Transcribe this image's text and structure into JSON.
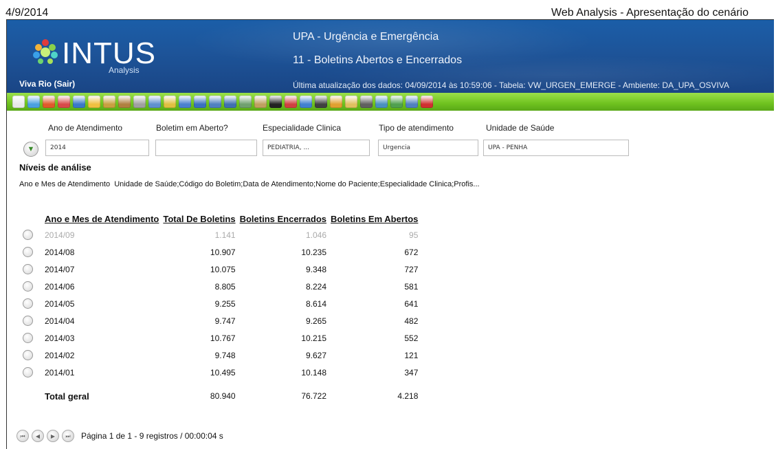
{
  "print_header": {
    "date": "4/9/2014",
    "title": "Web Analysis - Apresentação do cenário"
  },
  "banner": {
    "logo_text": "INTUS",
    "logo_sub": "Analysis",
    "user_link": "Viva Rio (Sair)",
    "report_title": "UPA - Urgência e Emergência",
    "report_subtitle": "11 - Boletins Abertos e Encerrados",
    "update_info": "Última atualização dos dados: 04/09/2014 às 10:59:06 - Tabela: VW_URGEN_EMERGE - Ambiente: DA_UPA_OSVIVA"
  },
  "toolbar": {
    "icons": [
      {
        "name": "home-icon",
        "color": "#e8e8e8"
      },
      {
        "name": "refresh-icon",
        "color": "#4aa0e0"
      },
      {
        "name": "pin-icon",
        "color": "#e05a2a"
      },
      {
        "name": "chart-config-icon",
        "color": "#d84a4a"
      },
      {
        "name": "presentation-icon",
        "color": "#3a78c8"
      },
      {
        "name": "drill-icon",
        "color": "#f0c040"
      },
      {
        "name": "filter-icon",
        "color": "#c8a040"
      },
      {
        "name": "filter-clear-icon",
        "color": "#b08040"
      },
      {
        "name": "ranking-icon",
        "color": "#a0a0a0"
      },
      {
        "name": "spellcheck-icon",
        "color": "#6090d0"
      },
      {
        "name": "columns-icon",
        "color": "#e0c040"
      },
      {
        "name": "table-icon",
        "color": "#4a80d0"
      },
      {
        "name": "rows-icon",
        "color": "#3a70c0"
      },
      {
        "name": "sum-icon",
        "color": "#5080c0"
      },
      {
        "name": "copy-icon",
        "color": "#4070b0"
      },
      {
        "name": "grid-icon",
        "color": "#70a070"
      },
      {
        "name": "bar-chart-icon",
        "color": "#c0a060"
      },
      {
        "name": "formula-icon",
        "color": "#222222"
      },
      {
        "name": "chart-icon",
        "color": "#d04040"
      },
      {
        "name": "line-chart-icon",
        "color": "#4080d0"
      },
      {
        "name": "globe-icon",
        "color": "#404040"
      },
      {
        "name": "hierarchy-icon",
        "color": "#e0a030"
      },
      {
        "name": "info-icon",
        "color": "#e0c060"
      },
      {
        "name": "print-icon",
        "color": "#606060"
      },
      {
        "name": "export-icon",
        "color": "#4a90c0"
      },
      {
        "name": "export-excel-icon",
        "color": "#50a050"
      },
      {
        "name": "window-icon",
        "color": "#5080c0"
      },
      {
        "name": "close-icon",
        "color": "#d03030"
      }
    ]
  },
  "filters": [
    {
      "label": "Ano de Atendimento",
      "value": "2014"
    },
    {
      "label": "Boletim em Aberto?",
      "value": ""
    },
    {
      "label": "Especialidade Clinica",
      "value": "PEDIATRIA, ..."
    },
    {
      "label": "Tipo de atendimento",
      "value": "Urgencia"
    },
    {
      "label": "Unidade de Saúde",
      "value": "UPA - PENHA"
    }
  ],
  "levels": {
    "title": "Níveis de análise",
    "current": "Ano e Mes de Atendimento",
    "rest": "Unidade de Saúde;Código do Boletim;Data de Atendimento;Nome do Paciente;Especialidade Clinica;Profis..."
  },
  "table": {
    "columns": [
      "Ano e Mes de Atendimento",
      "Total De Boletins",
      "Boletins Encerrados",
      "Boletins Em Abertos"
    ],
    "rows": [
      [
        "2014/09",
        "1.141",
        "1.046",
        "95"
      ],
      [
        "2014/08",
        "10.907",
        "10.235",
        "672"
      ],
      [
        "2014/07",
        "10.075",
        "9.348",
        "727"
      ],
      [
        "2014/06",
        "8.805",
        "8.224",
        "581"
      ],
      [
        "2014/05",
        "9.255",
        "8.614",
        "641"
      ],
      [
        "2014/04",
        "9.747",
        "9.265",
        "482"
      ],
      [
        "2014/03",
        "10.767",
        "10.215",
        "552"
      ],
      [
        "2014/02",
        "9.748",
        "9.627",
        "121"
      ],
      [
        "2014/01",
        "10.495",
        "10.148",
        "347"
      ]
    ],
    "total": [
      "Total geral",
      "80.940",
      "76.722",
      "4.218"
    ]
  },
  "pager": {
    "text": "Página 1 de 1 - 9 registros / 00:00:04 s"
  }
}
